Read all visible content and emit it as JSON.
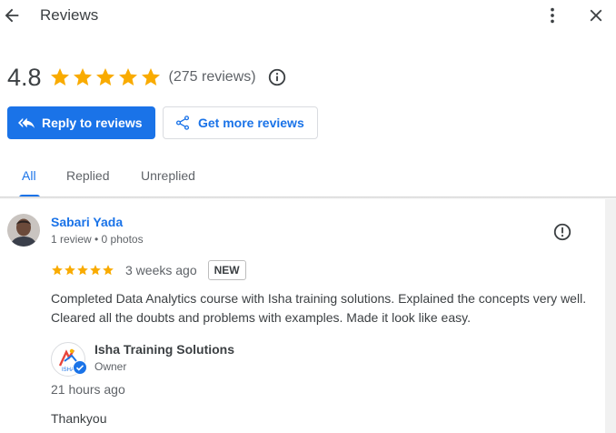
{
  "header": {
    "title": "Reviews",
    "back_icon": "arrow-back-icon",
    "more_icon": "more-vert-icon",
    "close_icon": "close-icon"
  },
  "summary": {
    "rating": "4.8",
    "star_count": 5,
    "rating_value": 4.8,
    "review_count": "(275 reviews)",
    "star_color": "#f9ab00",
    "info_icon": "info-icon"
  },
  "actions": {
    "reply_label": "Reply to reviews",
    "get_more_label": "Get more reviews",
    "accent": "#1a73e8"
  },
  "tabs": [
    {
      "label": "All",
      "active": true
    },
    {
      "label": "Replied",
      "active": false
    },
    {
      "label": "Unreplied",
      "active": false
    }
  ],
  "review": {
    "reviewer_name": "Sabari Yada",
    "reviewer_meta": "1 review • 0 photos",
    "stars": 5,
    "time": "3 weeks ago",
    "badge": "NEW",
    "text": "Completed Data Analytics course with Isha training solutions. Explained the concepts very well. Cleared all the doubts and problems with examples. Made it look like easy.",
    "flag_icon": "report-flag-icon",
    "reply": {
      "owner_name": "Isha Training Solutions",
      "owner_role": "Owner",
      "logo_text": "ISHA",
      "time": "21 hours ago",
      "text": "Thankyou"
    }
  }
}
